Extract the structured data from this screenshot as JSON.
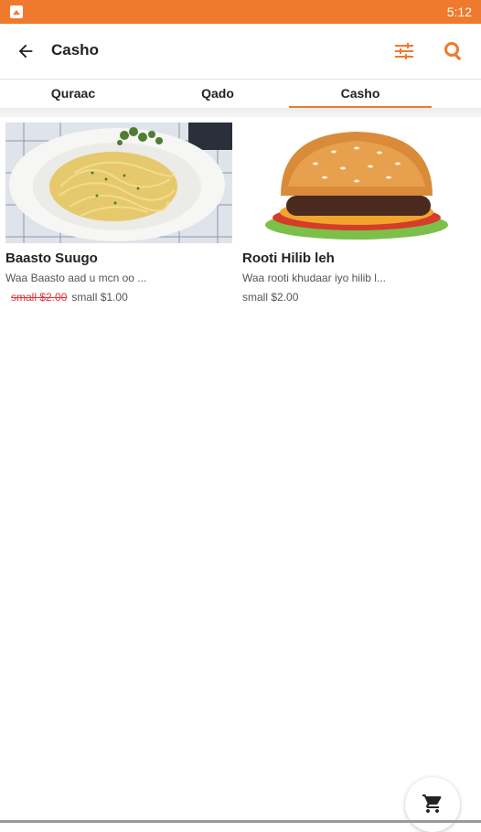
{
  "status_bar": {
    "time": "5:12",
    "app_icon": "app-notification-icon"
  },
  "app_bar": {
    "title": "Casho",
    "back_icon": "arrow-left-icon",
    "filter_icon": "sliders-icon",
    "search_icon": "search-icon"
  },
  "tabs": [
    {
      "label": "Quraac",
      "selected": false
    },
    {
      "label": "Qado",
      "selected": false
    },
    {
      "label": "Casho",
      "selected": true
    }
  ],
  "colors": {
    "accent": "#ef7a2e",
    "price_strike": "#e0343a"
  },
  "products": [
    {
      "name": "Baasto Suugo",
      "description": "Waa Baasto aad u mcn oo ...",
      "old_price": "small $2.00",
      "price": "small $1.00",
      "image": "pasta-plate-image"
    },
    {
      "name": "Rooti Hilib leh",
      "description": "Waa rooti khudaar iyo hilib l...",
      "price": "small $2.00",
      "image": "burger-image"
    }
  ],
  "cart_fab": {
    "icon": "shopping-cart-icon"
  }
}
